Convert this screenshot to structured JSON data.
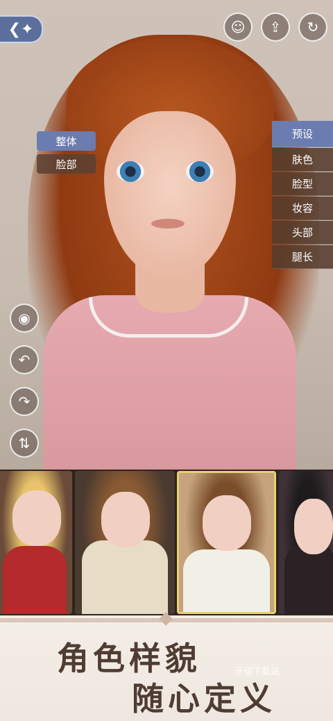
{
  "top_bar": {
    "back_icon": "back-arrow-icon",
    "buttons": [
      {
        "name": "avatar-icon",
        "glyph": "☺"
      },
      {
        "name": "share-icon",
        "glyph": "⇪"
      },
      {
        "name": "reset-icon",
        "glyph": "↻"
      }
    ]
  },
  "left_tabs": [
    {
      "label": "整体",
      "active": true
    },
    {
      "label": "脸部",
      "active": false
    }
  ],
  "right_menu": [
    {
      "label": "预设",
      "active": true
    },
    {
      "label": "肤色",
      "active": false
    },
    {
      "label": "脸型",
      "active": false
    },
    {
      "label": "妆容",
      "active": false
    },
    {
      "label": "头部",
      "active": false
    },
    {
      "label": "腿长",
      "active": false
    }
  ],
  "side_tools": [
    {
      "name": "eye-icon",
      "glyph": "◉"
    },
    {
      "name": "undo-icon",
      "glyph": "↶"
    },
    {
      "name": "redo-icon",
      "glyph": "↷"
    },
    {
      "name": "swap-icon",
      "glyph": "⇅"
    }
  ],
  "presets": [
    {
      "name": "preset-1",
      "hair": "#e8c36b",
      "outfit": "#b52a2a",
      "bg": "#6a4a38",
      "selected": false
    },
    {
      "name": "preset-2",
      "hair": "#8a5a32",
      "outfit": "#e7ddc6",
      "bg": "#4a3a30",
      "selected": false
    },
    {
      "name": "preset-3",
      "hair": "#7a4d2a",
      "outfit": "#f1f0e6",
      "bg": "#c6a37d",
      "selected": true
    },
    {
      "name": "preset-4",
      "hair": "#1e1b1d",
      "outfit": "#2a2225",
      "bg": "#3e3236",
      "selected": false
    }
  ],
  "footer": {
    "slogan_line1": "角色样貌",
    "slogan_line2": "随心定义",
    "watermark": "沃德下载站"
  }
}
